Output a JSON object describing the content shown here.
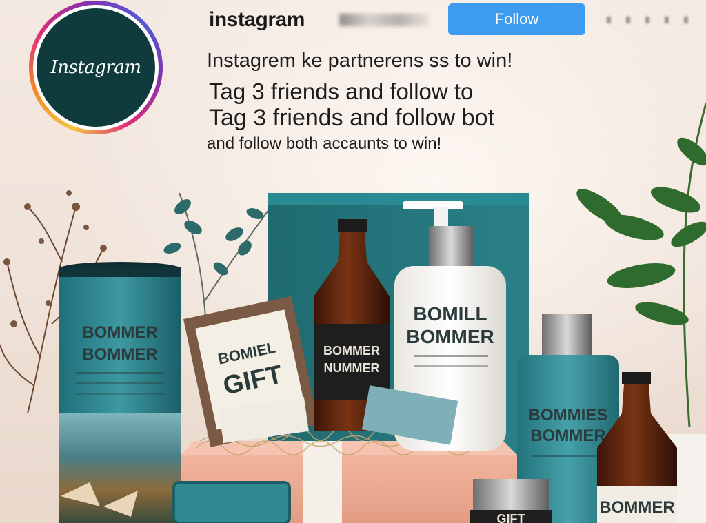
{
  "profile": {
    "avatar_text": "Instagram",
    "handle": "instagram",
    "follow_label": "Follow"
  },
  "caption": {
    "line1": "Instagrem ke partnerens ss to win!",
    "line2": "Tag 3 friends and follow to",
    "line3": "Tag 3 friends and follow bot",
    "line4": "and follow both accaunts to win!"
  },
  "products": {
    "tin_label_1": "BOMMER",
    "tin_label_2": "BOMMER",
    "card_label_1": "BOMIEL",
    "card_label_2": "GIFT",
    "bottle_label_1": "BOMMER",
    "bottle_label_2": "NUMMER",
    "pump_label_1": "BOMILL",
    "pump_label_2": "BOMMER",
    "right_bottle_label_1": "BOMMIES",
    "right_bottle_label_2": "BOMMER",
    "small_bottle_label": "BOMMER",
    "small_box_label": "GIFT"
  },
  "colors": {
    "follow_blue": "#3d9bf0",
    "teal": "#2f8a92",
    "amber": "#5a2410",
    "avatar_bg": "#103b3c"
  }
}
